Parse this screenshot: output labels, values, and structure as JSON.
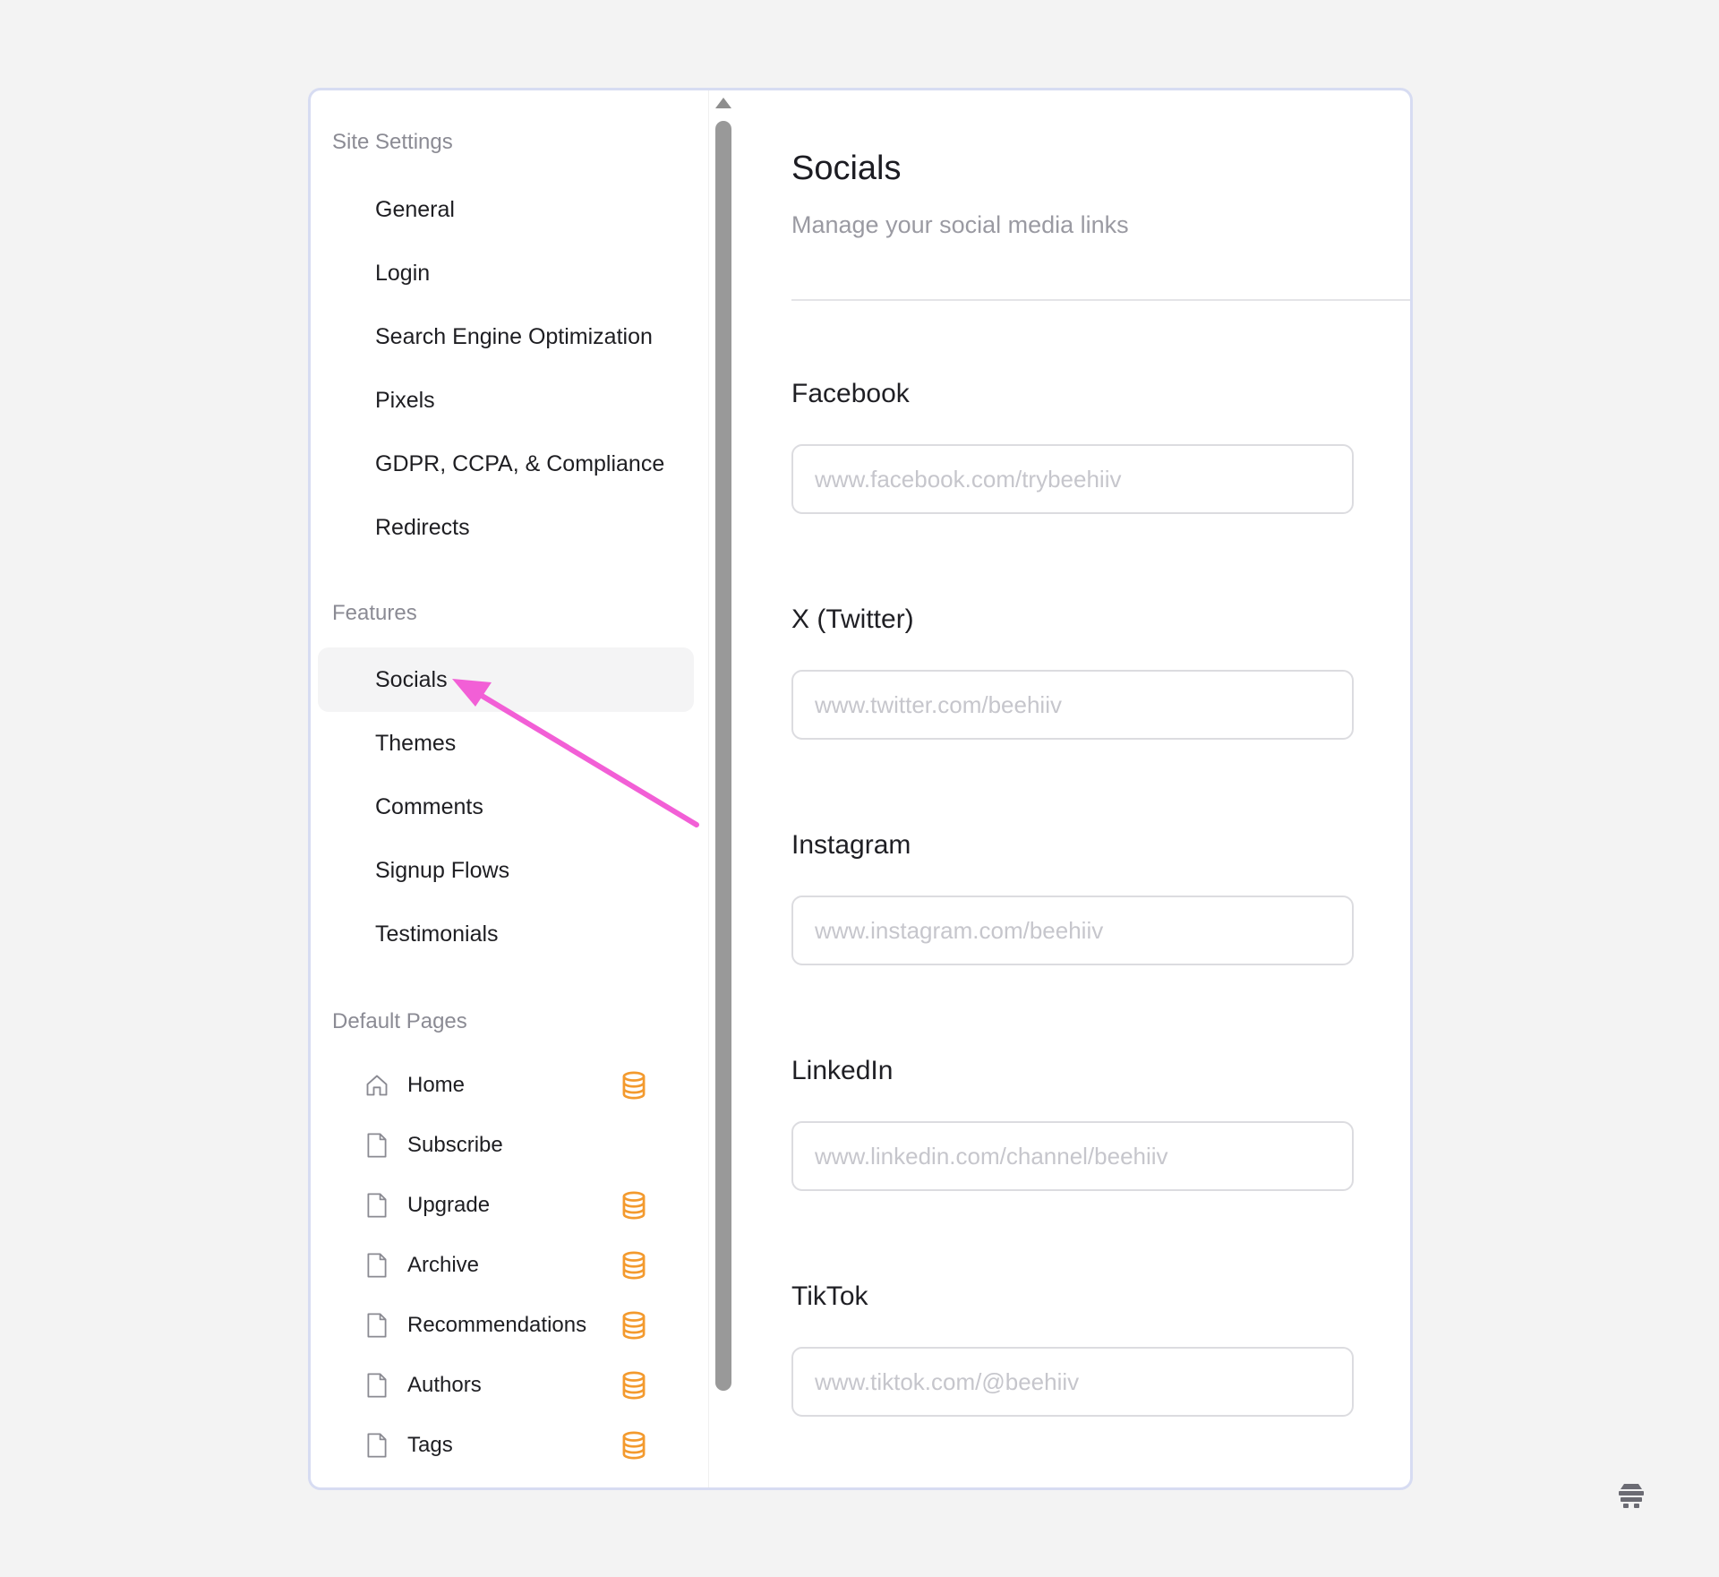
{
  "sidebar": {
    "sections": {
      "site_settings": "Site Settings",
      "features": "Features",
      "default_pages": "Default Pages"
    },
    "site_settings_items": [
      {
        "label": "General"
      },
      {
        "label": "Login"
      },
      {
        "label": "Search Engine Optimization"
      },
      {
        "label": "Pixels"
      },
      {
        "label": "GDPR, CCPA, & Compliance"
      },
      {
        "label": "Redirects"
      }
    ],
    "features_items": [
      {
        "label": "Socials",
        "active": true
      },
      {
        "label": "Themes"
      },
      {
        "label": "Comments"
      },
      {
        "label": "Signup Flows"
      },
      {
        "label": "Testimonials"
      }
    ],
    "default_pages": [
      {
        "label": "Home",
        "icon": "home-icon",
        "premium": true
      },
      {
        "label": "Subscribe",
        "icon": "page-icon",
        "premium": false
      },
      {
        "label": "Upgrade",
        "icon": "page-icon",
        "premium": true
      },
      {
        "label": "Archive",
        "icon": "page-icon",
        "premium": true
      },
      {
        "label": "Recommendations",
        "icon": "page-icon",
        "premium": true
      },
      {
        "label": "Authors",
        "icon": "page-icon",
        "premium": true
      },
      {
        "label": "Tags",
        "icon": "page-icon",
        "premium": true
      }
    ]
  },
  "main": {
    "title": "Socials",
    "subtitle": "Manage your social media links",
    "fields": [
      {
        "label": "Facebook",
        "placeholder": "www.facebook.com/trybeehiiv"
      },
      {
        "label": "X (Twitter)",
        "placeholder": "www.twitter.com/beehiiv"
      },
      {
        "label": "Instagram",
        "placeholder": "www.instagram.com/beehiiv"
      },
      {
        "label": "LinkedIn",
        "placeholder": "www.linkedin.com/channel/beehiiv"
      },
      {
        "label": "TikTok",
        "placeholder": "www.tiktok.com/@beehiiv"
      }
    ]
  },
  "colors": {
    "accent_arrow": "#f25fd6",
    "coin": "#f39a2e",
    "panel_border": "#d7dcf2"
  }
}
